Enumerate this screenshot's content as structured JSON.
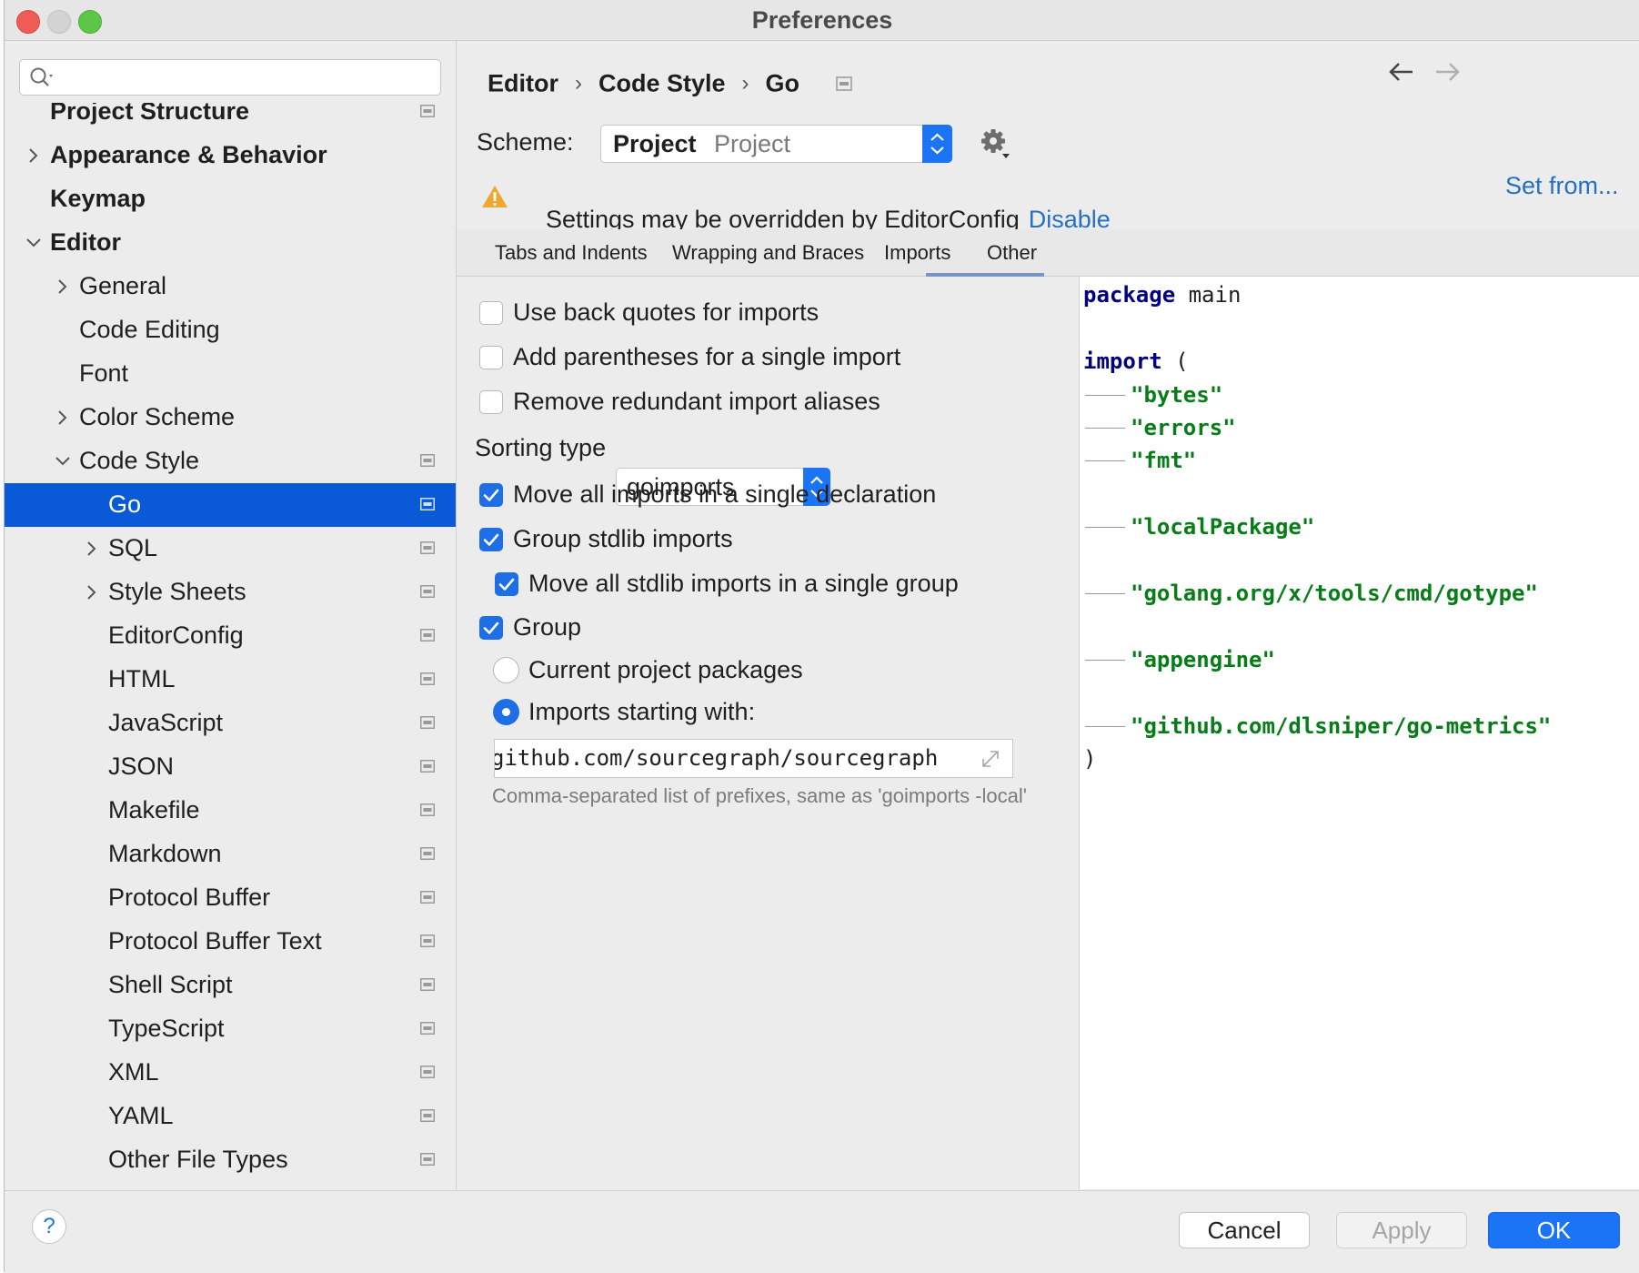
{
  "window": {
    "title": "Preferences"
  },
  "search": {
    "placeholder": ""
  },
  "sidebar": {
    "items": [
      {
        "label": "Project Structure",
        "level": 0,
        "bold": true,
        "chevron": "none",
        "project_icon": true
      },
      {
        "label": "Appearance & Behavior",
        "level": 0,
        "bold": true,
        "chevron": "right",
        "project_icon": false
      },
      {
        "label": "Keymap",
        "level": 0,
        "bold": true,
        "chevron": "none",
        "project_icon": false
      },
      {
        "label": "Editor",
        "level": 0,
        "bold": true,
        "chevron": "down",
        "project_icon": false
      },
      {
        "label": "General",
        "level": 1,
        "bold": false,
        "chevron": "right",
        "project_icon": false
      },
      {
        "label": "Code Editing",
        "level": 1,
        "bold": false,
        "chevron": "none",
        "project_icon": false
      },
      {
        "label": "Font",
        "level": 1,
        "bold": false,
        "chevron": "none",
        "project_icon": false
      },
      {
        "label": "Color Scheme",
        "level": 1,
        "bold": false,
        "chevron": "right",
        "project_icon": false
      },
      {
        "label": "Code Style",
        "level": 1,
        "bold": false,
        "chevron": "down",
        "project_icon": true
      },
      {
        "label": "Go",
        "level": 2,
        "bold": false,
        "chevron": "none",
        "project_icon": true,
        "selected": true
      },
      {
        "label": "SQL",
        "level": 2,
        "bold": false,
        "chevron": "right",
        "project_icon": true
      },
      {
        "label": "Style Sheets",
        "level": 2,
        "bold": false,
        "chevron": "right",
        "project_icon": true
      },
      {
        "label": "EditorConfig",
        "level": 2,
        "bold": false,
        "chevron": "none",
        "project_icon": true
      },
      {
        "label": "HTML",
        "level": 2,
        "bold": false,
        "chevron": "none",
        "project_icon": true
      },
      {
        "label": "JavaScript",
        "level": 2,
        "bold": false,
        "chevron": "none",
        "project_icon": true
      },
      {
        "label": "JSON",
        "level": 2,
        "bold": false,
        "chevron": "none",
        "project_icon": true
      },
      {
        "label": "Makefile",
        "level": 2,
        "bold": false,
        "chevron": "none",
        "project_icon": true
      },
      {
        "label": "Markdown",
        "level": 2,
        "bold": false,
        "chevron": "none",
        "project_icon": true
      },
      {
        "label": "Protocol Buffer",
        "level": 2,
        "bold": false,
        "chevron": "none",
        "project_icon": true
      },
      {
        "label": "Protocol Buffer Text",
        "level": 2,
        "bold": false,
        "chevron": "none",
        "project_icon": true
      },
      {
        "label": "Shell Script",
        "level": 2,
        "bold": false,
        "chevron": "none",
        "project_icon": true
      },
      {
        "label": "TypeScript",
        "level": 2,
        "bold": false,
        "chevron": "none",
        "project_icon": true
      },
      {
        "label": "XML",
        "level": 2,
        "bold": false,
        "chevron": "none",
        "project_icon": true
      },
      {
        "label": "YAML",
        "level": 2,
        "bold": false,
        "chevron": "none",
        "project_icon": true
      },
      {
        "label": "Other File Types",
        "level": 2,
        "bold": false,
        "chevron": "none",
        "project_icon": true
      }
    ]
  },
  "breadcrumb": {
    "items": [
      "Editor",
      "Code Style",
      "Go"
    ],
    "separator": "›"
  },
  "nav": {
    "back_icon": "arrow-left-icon",
    "forward_icon": "arrow-right-icon"
  },
  "scheme": {
    "label": "Scheme:",
    "value": "Project",
    "secondary": "Project"
  },
  "set_from": {
    "label": "Set from..."
  },
  "warning": {
    "text": "Settings may be overridden by EditorConfig",
    "link": "Disable"
  },
  "tabs": {
    "items": [
      "Tabs and Indents",
      "Wrapping and Braces",
      "Imports",
      "Other"
    ],
    "active": "Imports"
  },
  "options": {
    "checkboxes": [
      {
        "label": "Use back quotes for imports",
        "checked": false
      },
      {
        "label": "Add parentheses for a single import",
        "checked": false
      },
      {
        "label": "Remove redundant import aliases",
        "checked": false
      },
      {
        "label": "Move all imports in a single declaration",
        "checked": true
      },
      {
        "label": "Group stdlib imports",
        "checked": true
      },
      {
        "label": "Move all stdlib imports in a single group",
        "checked": true
      },
      {
        "label": "Group",
        "checked": true
      }
    ],
    "sorting": {
      "label": "Sorting type",
      "value": "goimports"
    },
    "radios": [
      {
        "label": "Current project packages",
        "checked": false
      },
      {
        "label": "Imports starting with:",
        "checked": true
      }
    ],
    "prefix_value": "github.com/sourcegraph/sourcegraph",
    "hint": "Comma-separated list of prefixes, same as 'goimports -local'"
  },
  "preview": {
    "package_kw": "package",
    "package_name": "main",
    "import_kw": "import",
    "open_paren": "(",
    "close_paren": ")",
    "imports": [
      "\"bytes\"",
      "\"errors\"",
      "\"fmt\"",
      "\"localPackage\"",
      "\"golang.org/x/tools/cmd/gotype\"",
      "\"appengine\"",
      "\"github.com/dlsniper/go-metrics\""
    ]
  },
  "footer": {
    "help": "?",
    "cancel": "Cancel",
    "apply": "Apply",
    "ok": "OK"
  },
  "colors": {
    "accent": "#0a59d6",
    "button_primary": "#1a74f5",
    "link": "#2470c4",
    "string": "#067d17",
    "keyword": "#000080"
  }
}
